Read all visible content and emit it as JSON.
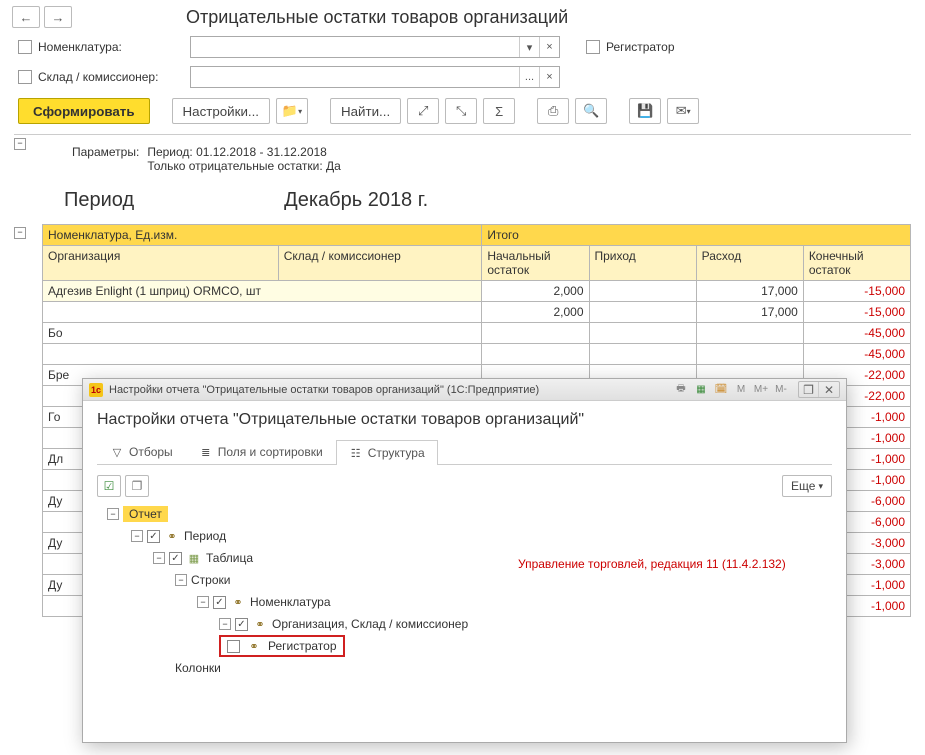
{
  "title": "Отрицательные остатки товаров организаций",
  "filters": {
    "nomenclature_label": "Номенклатура:",
    "warehouse_label": "Склад / комиссионер:",
    "registrator_label": "Регистратор",
    "dropdown_sym": "▾",
    "ellipsis_sym": "...",
    "clear_sym": "×"
  },
  "toolbar": {
    "generate": "Сформировать",
    "settings": "Настройки...",
    "find": "Найти..."
  },
  "report": {
    "params_label": "Параметры:",
    "params_line1": "Период: 01.12.2018 - 31.12.2018",
    "params_line2": "Только отрицательные остатки: Да",
    "period_label": "Период",
    "period_value": "Декабрь 2018 г.",
    "headers": {
      "h1a": "Номенклатура, Ед.изм.",
      "h1b": "Итого",
      "h2a": "Организация",
      "h2b": "Склад / комиссионер",
      "h3a": "Начальный остаток",
      "h3b": "Приход",
      "h3c": "Расход",
      "h3d": "Конечный остаток"
    },
    "rows": [
      {
        "label": "Адгезив Enlight (1 шприц) ORMCO, шт",
        "c1": "2,000",
        "c2": "",
        "c3": "17,000",
        "c4": "-15,000",
        "neg": true,
        "hl": true
      },
      {
        "label": "",
        "c1": "2,000",
        "c2": "",
        "c3": "17,000",
        "c4": "-15,000",
        "neg": true
      },
      {
        "label": "Бо",
        "c1": "",
        "c2": "",
        "c3": "",
        "c4": "-45,000",
        "neg": true
      },
      {
        "label": "",
        "c1": "",
        "c2": "",
        "c3": "",
        "c4": "-45,000",
        "neg": true
      },
      {
        "label": "Бре",
        "c1": "",
        "c2": "",
        "c3": "",
        "c4": "-22,000",
        "neg": true
      },
      {
        "label": "",
        "c1": "",
        "c2": "",
        "c3": "",
        "c4": "-22,000",
        "neg": true
      },
      {
        "label": "Го",
        "c1": "",
        "c2": "",
        "c3": "",
        "c4": "-1,000",
        "neg": true
      },
      {
        "label": "",
        "c1": "",
        "c2": "",
        "c3": "",
        "c4": "-1,000",
        "neg": true
      },
      {
        "label": "Дл",
        "c1": "",
        "c2": "",
        "c3": "",
        "c4": "-1,000",
        "neg": true
      },
      {
        "label": "",
        "c1": "",
        "c2": "",
        "c3": "",
        "c4": "-1,000",
        "neg": true
      },
      {
        "label": "Ду",
        "c1": "",
        "c2": "",
        "c3": "",
        "c4": "-6,000",
        "neg": true
      },
      {
        "label": "",
        "c1": "",
        "c2": "",
        "c3": "",
        "c4": "-6,000",
        "neg": true
      },
      {
        "label": "Ду",
        "c1": "",
        "c2": "",
        "c3": "",
        "c4": "-3,000",
        "neg": true
      },
      {
        "label": "",
        "c1": "",
        "c2": "",
        "c3": "",
        "c4": "-3,000",
        "neg": true
      },
      {
        "label": "Ду",
        "c1": "",
        "c2": "",
        "c3": "",
        "c4": "-1,000",
        "neg": true
      },
      {
        "label": "",
        "c1": "",
        "c2": "",
        "c3": "",
        "c4": "-1,000",
        "neg": true
      }
    ]
  },
  "dialog": {
    "titlebar": "Настройки отчета \"Отрицательные остатки товаров организаций\"  (1С:Предприятие)",
    "tb_m": "M",
    "tb_mplus": "M+",
    "tb_mminus": "M-",
    "heading": "Настройки отчета \"Отрицательные остатки товаров организаций\"",
    "tab_filters": "Отборы",
    "tab_fields": "Поля и сортировки",
    "tab_structure": "Структура",
    "more": "Еще",
    "tree": {
      "root": "Отчет",
      "period": "Период",
      "table": "Таблица",
      "rows": "Строки",
      "nomen": "Номенклатура",
      "org": "Организация, Склад / комиссионер",
      "reg": "Регистратор",
      "cols": "Колонки"
    },
    "version": "Управление торговлей, редакция 11 (11.4.2.132)"
  },
  "glyphs": {
    "back": "←",
    "fwd": "→",
    "down": "▾",
    "sum": "Σ",
    "print": "⎙",
    "mag": "🔍",
    "save": "💾",
    "mail": "✉",
    "chain": "⚭",
    "table": "▦",
    "check": "☑",
    "copy": "❐",
    "funnel": "▽",
    "list": "≣",
    "struct": "☷"
  }
}
